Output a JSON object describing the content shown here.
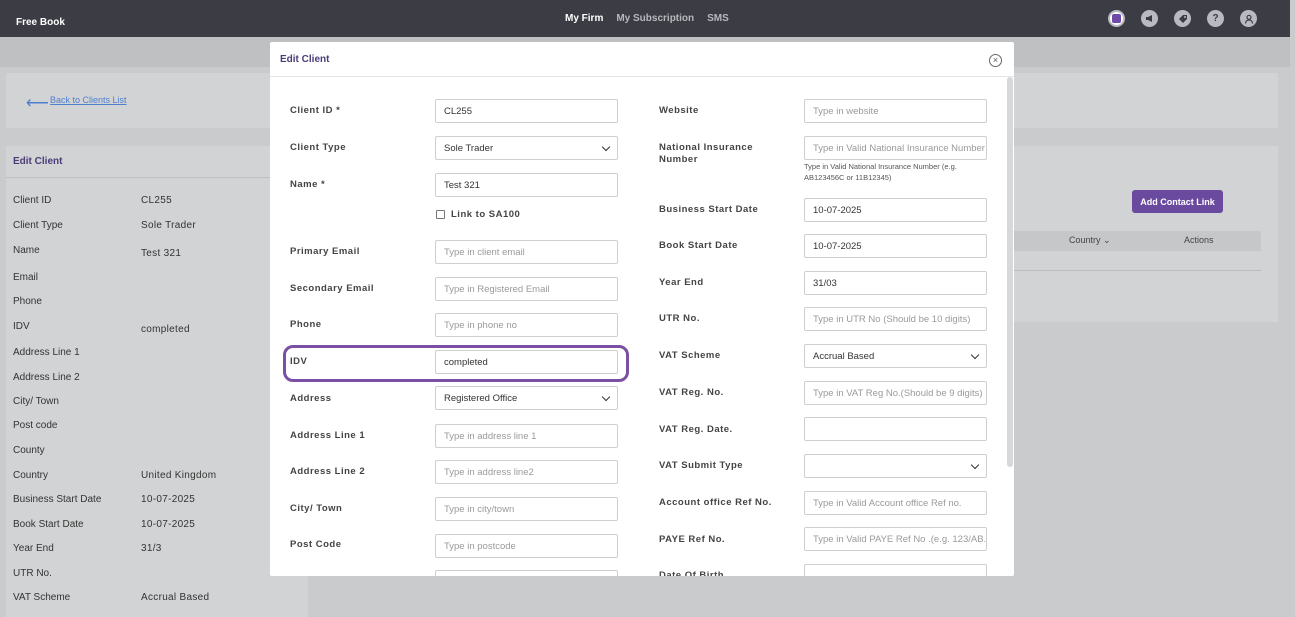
{
  "topbar": {
    "brand": "Free Book",
    "nav": [
      "My Firm",
      "My Subscription",
      "SMS"
    ],
    "icons": [
      "app-icon",
      "megaphone-icon",
      "tag-icon",
      "help-icon",
      "user-icon"
    ],
    "help_glyph": "?"
  },
  "back": {
    "label": "Back to Clients List"
  },
  "left_card": {
    "title": "Edit Client",
    "rows": [
      {
        "k": "Client ID",
        "v": "CL255"
      },
      {
        "k": "Client Type",
        "v": "Sole Trader"
      },
      {
        "k": "Name",
        "v": "Test 321"
      },
      {
        "k": "Email",
        "v": ""
      },
      {
        "k": "Phone",
        "v": ""
      },
      {
        "k": "IDV",
        "v": "completed"
      },
      {
        "k": "Address Line 1",
        "v": ""
      },
      {
        "k": "Address Line 2",
        "v": ""
      },
      {
        "k": "City/ Town",
        "v": ""
      },
      {
        "k": "Post code",
        "v": ""
      },
      {
        "k": "County",
        "v": ""
      },
      {
        "k": "Country",
        "v": "United Kingdom"
      },
      {
        "k": "Business Start Date",
        "v": "10-07-2025"
      },
      {
        "k": "Book Start Date",
        "v": "10-07-2025"
      },
      {
        "k": "Year End",
        "v": "31/3"
      },
      {
        "k": "UTR No.",
        "v": ""
      },
      {
        "k": "VAT Scheme",
        "v": "Accrual Based"
      }
    ]
  },
  "right_card": {
    "add_button": "Add Contact Link",
    "columns": [
      "Country",
      "Actions"
    ]
  },
  "modal": {
    "title": "Edit Client",
    "close": "×",
    "left_fields": [
      {
        "label": "Client ID *",
        "value": "CL255",
        "placeholder": ""
      },
      {
        "label": "Client Type",
        "value": "Sole Trader",
        "placeholder": "",
        "select": true
      },
      {
        "label": "Name *",
        "value": "Test 321",
        "placeholder": ""
      },
      {
        "label": "Primary Email",
        "value": "",
        "placeholder": "Type in client email"
      },
      {
        "label": "Secondary Email",
        "value": "",
        "placeholder": "Type in Registered Email"
      },
      {
        "label": "Phone",
        "value": "",
        "placeholder": "Type in phone no"
      },
      {
        "label": "IDV",
        "value": "completed",
        "placeholder": ""
      },
      {
        "label": "Address",
        "value": "Registered Office",
        "placeholder": "",
        "select": true
      },
      {
        "label": "Address Line 1",
        "value": "",
        "placeholder": "Type in address line 1"
      },
      {
        "label": "Address Line 2",
        "value": "",
        "placeholder": "Type in address line2"
      },
      {
        "label": "City/ Town",
        "value": "",
        "placeholder": "Type in city/town"
      },
      {
        "label": "Post Code",
        "value": "",
        "placeholder": "Type in postcode"
      },
      {
        "label": "",
        "value": "",
        "placeholder": ""
      }
    ],
    "sa100": "Link to SA100",
    "right_fields": [
      {
        "label": "Website",
        "value": "",
        "placeholder": "Type in website"
      },
      {
        "label": "National Insurance Number",
        "value": "",
        "placeholder": "Type in Valid National Insurance Number"
      },
      {
        "label": "Business Start Date",
        "value": "10-07-2025",
        "placeholder": ""
      },
      {
        "label": "Book Start Date",
        "value": "10-07-2025",
        "placeholder": ""
      },
      {
        "label": "Year End",
        "value": "31/03",
        "placeholder": ""
      },
      {
        "label": "UTR No.",
        "value": "",
        "placeholder": "Type in UTR No (Should be 10 digits)"
      },
      {
        "label": "VAT Scheme",
        "value": "Accrual Based",
        "placeholder": "",
        "select": true
      },
      {
        "label": "VAT Reg. No.",
        "value": "",
        "placeholder": "Type in VAT Reg No.(Should be 9 digits)"
      },
      {
        "label": "VAT Reg. Date.",
        "value": "",
        "placeholder": ""
      },
      {
        "label": "VAT Submit Type",
        "value": "",
        "placeholder": "",
        "select": true
      },
      {
        "label": "Account office Ref No.",
        "value": "",
        "placeholder": "Type in Valid Account office Ref no."
      },
      {
        "label": "PAYE Ref No.",
        "value": "",
        "placeholder": "Type in Valid PAYE Ref No .(e.g. 123/AB..."
      },
      {
        "label": "Date Of Birth",
        "value": "",
        "placeholder": ""
      }
    ],
    "ni_hint": "Type in Valid National Insurance Number (e.g. AB123456C or 11B12345)"
  },
  "colors": {
    "accent": "#6a4a9e",
    "topbar": "#3c3d44",
    "highlight": "#7b4fa3"
  }
}
